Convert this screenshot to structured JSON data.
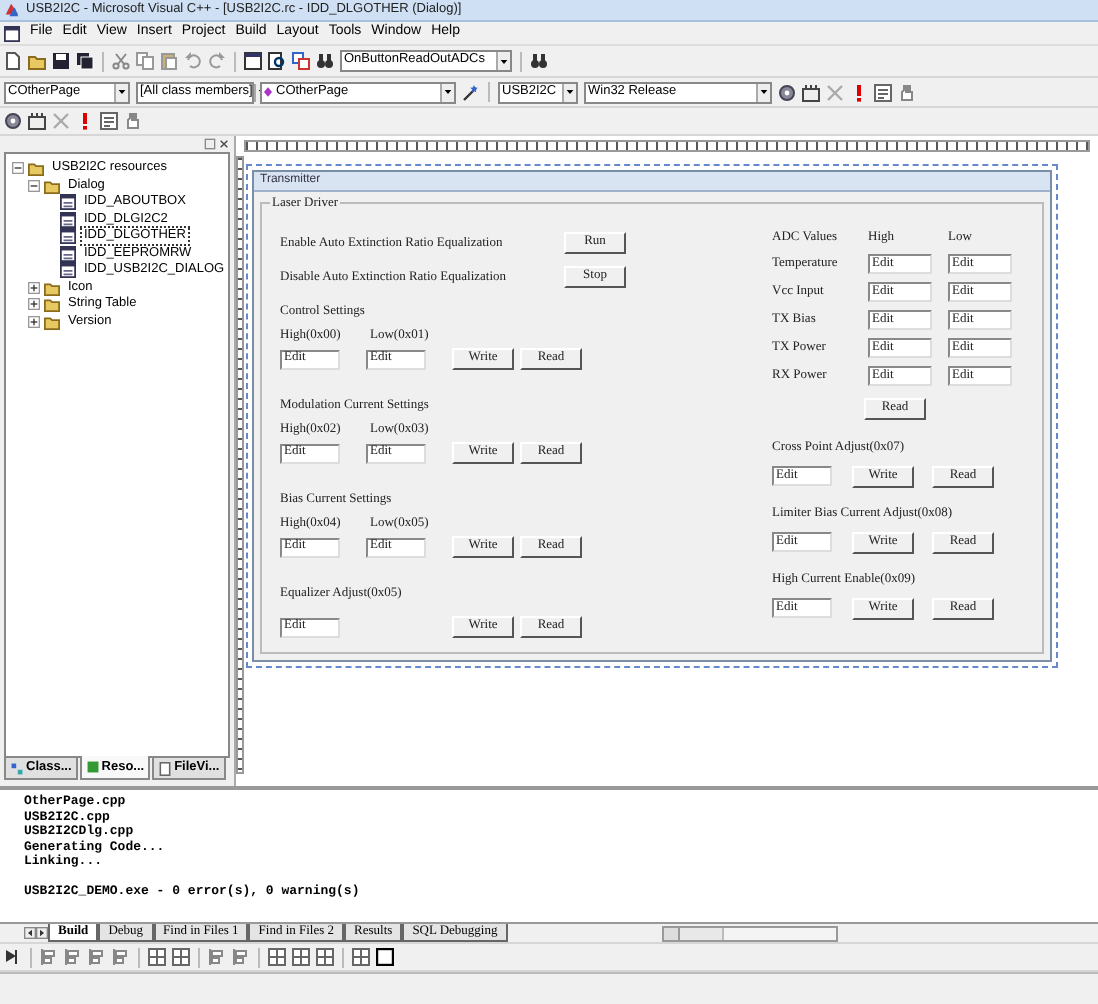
{
  "window": {
    "title": "USB2I2C - Microsoft Visual C++ - [USB2I2C.rc - IDD_DLGOTHER (Dialog)]"
  },
  "menu": [
    "File",
    "Edit",
    "View",
    "Insert",
    "Project",
    "Build",
    "Layout",
    "Tools",
    "Window",
    "Help"
  ],
  "toolbar": {
    "function_combo": "OnButtonReadOutADCs"
  },
  "wizard_bar": {
    "class_combo": "COtherPage",
    "filter_combo": "[All class members]",
    "member_combo": "COtherPage",
    "project_combo": "USB2I2C",
    "config_combo": "Win32 Release"
  },
  "resource_tree": [
    {
      "label": "USB2I2C resources",
      "expanded": true,
      "selected": false,
      "children": [
        {
          "label": "Dialog",
          "expanded": true,
          "selected": false,
          "children": [
            {
              "label": "IDD_ABOUTBOX",
              "selected": false
            },
            {
              "label": "IDD_DLGI2C2",
              "selected": false
            },
            {
              "label": "IDD_DLGOTHER",
              "selected": true
            },
            {
              "label": "IDD_EEPROMRW",
              "selected": false
            },
            {
              "label": "IDD_USB2I2C_DIALOG",
              "selected": false
            }
          ]
        },
        {
          "label": "Icon",
          "expanded": false,
          "selected": false
        },
        {
          "label": "String Table",
          "expanded": false,
          "selected": false
        },
        {
          "label": "Version",
          "expanded": false,
          "selected": false
        }
      ]
    }
  ],
  "workspace_tabs": [
    {
      "label": "Class...",
      "selected": false
    },
    {
      "label": "Reso...",
      "selected": true
    },
    {
      "label": "FileVi...",
      "selected": false
    }
  ],
  "dialog": {
    "title": "Transmitter",
    "group": "Laser Driver",
    "actions": [
      {
        "label": "Enable Auto Extinction Ratio Equalization",
        "button": "Run"
      },
      {
        "label": "Disable Auto Extinction Ratio Equalization",
        "button": "Stop"
      }
    ],
    "settings": [
      {
        "heading": "Control Settings",
        "fields": [
          {
            "label": "High(0x00)",
            "value": "Edit"
          },
          {
            "label": "Low(0x01)",
            "value": "Edit"
          }
        ],
        "buttons": [
          "Write",
          "Read"
        ]
      },
      {
        "heading": "Modulation Current Settings",
        "fields": [
          {
            "label": "High(0x02)",
            "value": "Edit"
          },
          {
            "label": "Low(0x03)",
            "value": "Edit"
          }
        ],
        "buttons": [
          "Write",
          "Read"
        ]
      },
      {
        "heading": "Bias Current Settings",
        "fields": [
          {
            "label": "High(0x04)",
            "value": "Edit"
          },
          {
            "label": "Low(0x05)",
            "value": "Edit"
          }
        ],
        "buttons": [
          "Write",
          "Read"
        ]
      },
      {
        "heading": "Equalizer Adjust(0x05)",
        "fields": [
          {
            "value": "Edit"
          }
        ],
        "buttons": [
          "Write",
          "Read"
        ]
      }
    ],
    "adc": {
      "columns": [
        "ADC Values",
        "High",
        "Low"
      ],
      "rows": [
        {
          "label": "Temperature",
          "high": "Edit",
          "low": "Edit"
        },
        {
          "label": "Vcc Input",
          "high": "Edit",
          "low": "Edit"
        },
        {
          "label": "TX Bias",
          "high": "Edit",
          "low": "Edit"
        },
        {
          "label": "TX Power",
          "high": "Edit",
          "low": "Edit"
        },
        {
          "label": "RX Power",
          "high": "Edit",
          "low": "Edit"
        }
      ],
      "button": "Read"
    },
    "adjustments": [
      {
        "heading": "Cross Point Adjust(0x07)",
        "value": "Edit",
        "buttons": [
          "Write",
          "Read"
        ]
      },
      {
        "heading": "Limiter Bias Current Adjust(0x08)",
        "value": "Edit",
        "buttons": [
          "Write",
          "Read"
        ]
      },
      {
        "heading": "High Current Enable(0x09)",
        "value": "Edit",
        "buttons": [
          "Write",
          "Read"
        ]
      }
    ]
  },
  "output": {
    "lines": [
      "OtherPage.cpp",
      "USB2I2C.cpp",
      "USB2I2CDlg.cpp",
      "Generating Code...",
      "Linking..."
    ],
    "summary": "USB2I2C_DEMO.exe - 0 error(s), 0 warning(s)",
    "tabs": [
      {
        "label": "Build",
        "selected": true
      },
      {
        "label": "Debug",
        "selected": false
      },
      {
        "label": "Find in Files 1",
        "selected": false
      },
      {
        "label": "Find in Files 2",
        "selected": false
      },
      {
        "label": "Results",
        "selected": false
      },
      {
        "label": "SQL Debugging",
        "selected": false
      }
    ]
  }
}
